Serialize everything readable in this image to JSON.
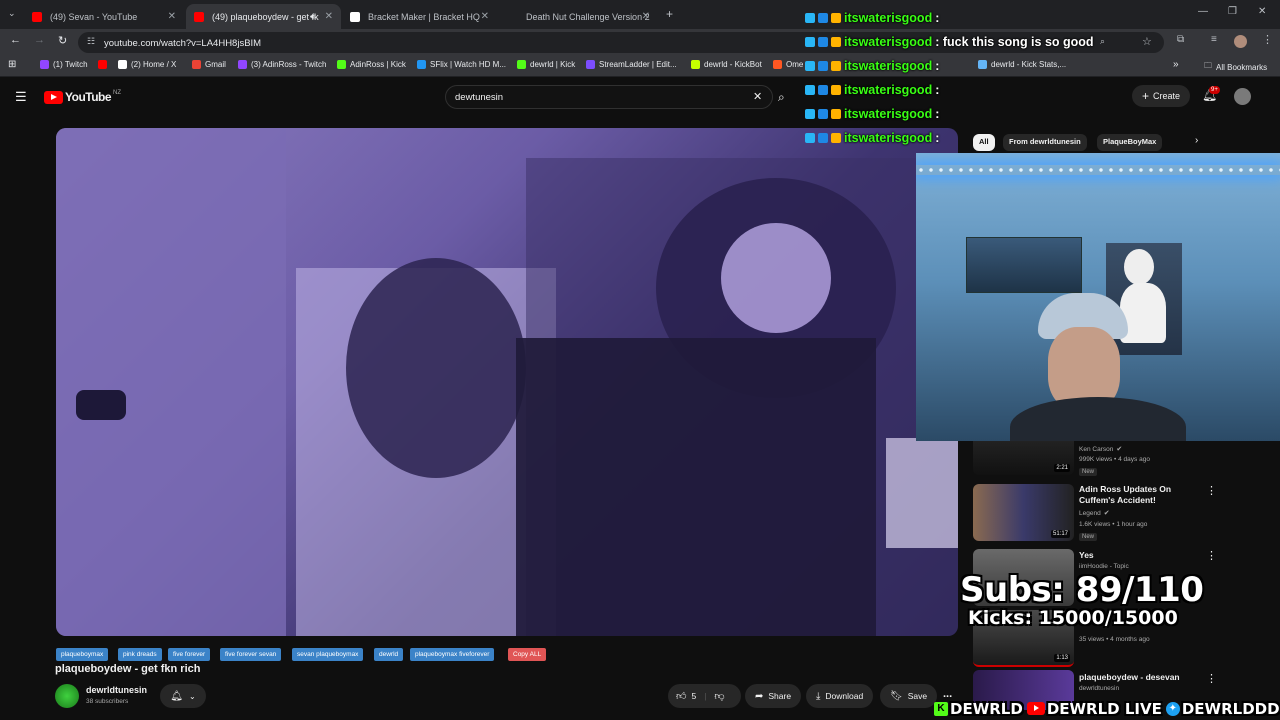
{
  "browser": {
    "tabs": [
      {
        "label": "(49) Sevan - YouTube",
        "fav": "#ff0000"
      },
      {
        "label": "(49) plaqueboydew - get fk",
        "fav": "#ff0000"
      },
      {
        "label": "Bracket Maker | Bracket HQ",
        "fav": "#ffffff"
      },
      {
        "label": "Death Nut Challenge Version 2",
        "fav": "#cccccc"
      }
    ],
    "new_tab": "+",
    "url": "youtube.com/watch?v=LA4HH8jsBIM",
    "bookmarks": [
      {
        "label": "(1) Twitch",
        "color": "#9146ff"
      },
      {
        "label": "",
        "color": "#ff0000"
      },
      {
        "label": "(2) Home / X",
        "color": "#ffffff"
      },
      {
        "label": "Gmail",
        "color": "#ea4335"
      },
      {
        "label": "(3) AdinRoss - Twitch",
        "color": "#9146ff"
      },
      {
        "label": "AdinRoss | Kick",
        "color": "#53fc18"
      },
      {
        "label": "SFlix | Watch HD M...",
        "color": "#2196f3"
      },
      {
        "label": "dewrld | Kick",
        "color": "#53fc18"
      },
      {
        "label": "StreamLadder | Edit...",
        "color": "#7c4dff"
      },
      {
        "label": "dewrld - KickBot",
        "color": "#c6ff00"
      },
      {
        "label": "Ome",
        "color": "#ff5722"
      },
      {
        "label": "dewrld - Kick Stats,...",
        "color": "#64b5f6"
      }
    ],
    "all_bookmarks": "All Bookmarks"
  },
  "youtube": {
    "logo": "YouTube",
    "region": "NZ",
    "search_value": "dewtunesin",
    "create_label": "Create",
    "notif_count": "9+",
    "filter_chips": [
      "All",
      "From dewrldtunesin",
      "PlaqueBoyMax"
    ],
    "video_title": "plaqueboydew - get fkn rich",
    "tags": [
      "plaqueboymax",
      "pink dreads",
      "five forever",
      "five forever sevan",
      "sevan plaqueboymax",
      "dewrld",
      "plaqueboymax fiveforever",
      "Copy ALL"
    ],
    "channel_name": "dewrldtunesin",
    "subscribers": "38 subscribers",
    "like_count": "5",
    "share_label": "Share",
    "download_label": "Download",
    "save_label": "Save",
    "more": "..."
  },
  "sidebar_videos": [
    {
      "title": "",
      "channel": "Ken Carson",
      "meta": "999K views • 4 days ago",
      "badge": "New",
      "duration": "2:21"
    },
    {
      "title": "Adin Ross Updates On Cuffem's Accident!",
      "channel": "Legend",
      "meta": "1.6K views • 1 hour ago",
      "badge": "New",
      "duration": "51:17"
    },
    {
      "title": "Yes",
      "channel": "iimHoodie - Topic",
      "meta": "104",
      "badge": "",
      "duration": ""
    },
    {
      "title": "",
      "channel": "",
      "meta": "35 views • 4 months ago",
      "badge": "",
      "duration": "1:13"
    },
    {
      "title": "plaqueboydew - desevan",
      "channel": "dewrldtunesin",
      "meta": "",
      "badge": "",
      "duration": ""
    }
  ],
  "chat": [
    {
      "user": "itswaterisgood",
      "msg": ":"
    },
    {
      "user": "itswaterisgood",
      "msg": ": fuck this song is so good"
    },
    {
      "user": "itswaterisgood",
      "msg": ":"
    },
    {
      "user": "itswaterisgood",
      "msg": ":"
    },
    {
      "user": "itswaterisgood",
      "msg": ":"
    },
    {
      "user": "itswaterisgood",
      "msg": ":"
    }
  ],
  "overlay": {
    "subs": "Subs: 89/110",
    "kicks": "Kicks: 15000/15000",
    "socials": [
      "DEWRLD",
      "DEWRLD LIVE",
      "DEWRLDDD"
    ]
  }
}
